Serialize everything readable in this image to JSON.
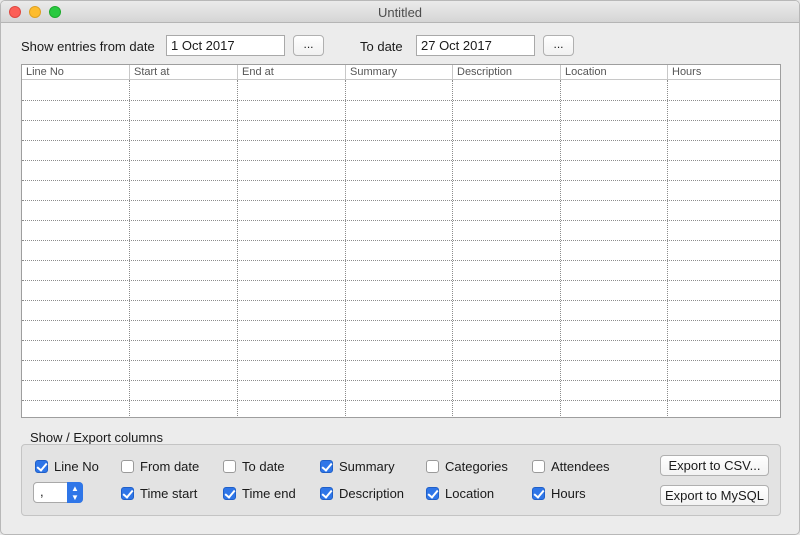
{
  "window": {
    "title": "Untitled"
  },
  "filter": {
    "from_label": "Show entries from date",
    "from_value": "1 Oct 2017",
    "from_picker": "...",
    "to_label": "To date",
    "to_value": "27 Oct 2017",
    "to_picker": "..."
  },
  "table": {
    "columns": [
      "Line No",
      "Start at",
      "End at",
      "Summary",
      "Description",
      "Location",
      "Hours"
    ]
  },
  "columns_group": {
    "label": "Show / Export columns",
    "checkboxes": [
      {
        "label": "Line No",
        "checked": true
      },
      {
        "label": "From date",
        "checked": false
      },
      {
        "label": "To date",
        "checked": false
      },
      {
        "label": "Summary",
        "checked": true
      },
      {
        "label": "Categories",
        "checked": false
      },
      {
        "label": "Attendees",
        "checked": false
      },
      {
        "label": "Time start",
        "checked": true
      },
      {
        "label": "Time end",
        "checked": true
      },
      {
        "label": "Description",
        "checked": true
      },
      {
        "label": "Location",
        "checked": true
      },
      {
        "label": "Hours",
        "checked": true
      }
    ],
    "separator_value": ",",
    "export_csv": "Export to CSV...",
    "export_mysql": "Export to MySQL"
  },
  "colors": {
    "accent": "#2f76e8",
    "close": "#fc5f57",
    "minimize": "#fdbc2e",
    "maximize": "#29c940"
  }
}
